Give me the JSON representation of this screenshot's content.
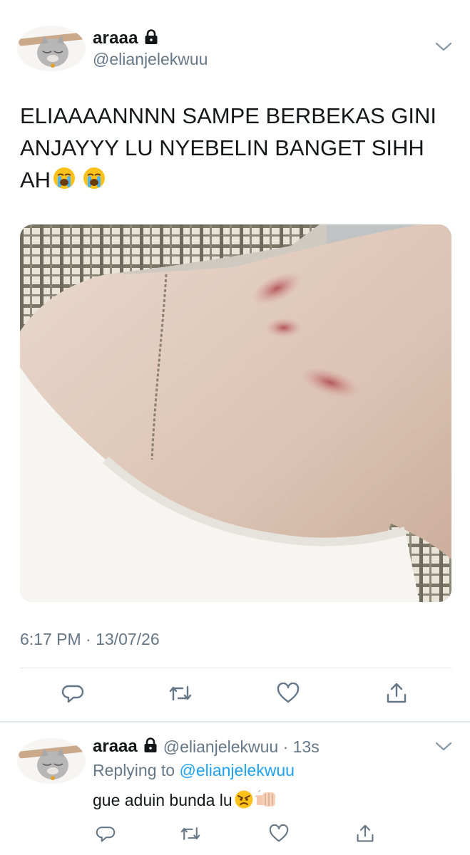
{
  "tweet": {
    "display_name": "araaa",
    "handle": "@elianjelekwuu",
    "text": "ELIAAAANNNN SAMPE BERBEKAS GINI ANJAYYY LU NYEBELIN BANGET SIHH AH",
    "emojis": [
      "loudly-crying-face-emoji",
      "loudly-crying-face-emoji"
    ],
    "timestamp": "6:17 PM · 13/07/26",
    "actions": [
      "reply-icon",
      "retweet-icon",
      "like-icon",
      "share-icon"
    ]
  },
  "reply": {
    "display_name": "araaa",
    "handle_time": "@elianjelekwuu · 13s",
    "replying_prefix": "Replying to ",
    "replying_handle": "@elianjelekwuu",
    "text": "gue aduin bunda lu",
    "emojis": [
      "angry-face-emoji",
      "fist-bump-emoji"
    ],
    "actions": [
      "reply-icon",
      "retweet-icon",
      "like-icon",
      "share-icon"
    ]
  },
  "colors": {
    "text": "#14171a",
    "secondary": "#657786",
    "link": "#1da1f2",
    "divider": "#e1e8ed"
  }
}
